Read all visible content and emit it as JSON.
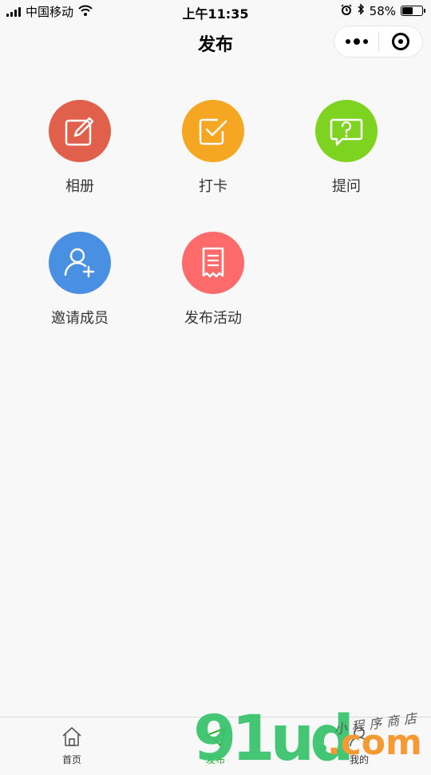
{
  "status_bar": {
    "carrier": "中国移动",
    "time": "上午11:35",
    "battery": "58%",
    "battery_level": 0.58
  },
  "nav": {
    "title": "发布"
  },
  "grid": {
    "items": [
      {
        "label": "相册",
        "icon": "edit-icon",
        "color": "#e0604c"
      },
      {
        "label": "打卡",
        "icon": "checkbox-icon",
        "color": "#f5a623"
      },
      {
        "label": "提问",
        "icon": "question-bubble-icon",
        "color": "#7ed321"
      },
      {
        "label": "邀请成员",
        "icon": "add-user-icon",
        "color": "#4a90e2"
      },
      {
        "label": "发布活动",
        "icon": "receipt-icon",
        "color": "#ff6b6b"
      }
    ]
  },
  "tabbar": {
    "tabs": [
      {
        "label": "首页",
        "icon": "home-icon"
      },
      {
        "label": "发布",
        "icon": "paper-plane-icon",
        "active": true
      },
      {
        "label": "我的",
        "icon": "user-icon"
      }
    ],
    "active_color": "#1aad19"
  },
  "watermark": {
    "brand": "91ud",
    "suffix": ".com",
    "tagline": "小程序商店"
  }
}
